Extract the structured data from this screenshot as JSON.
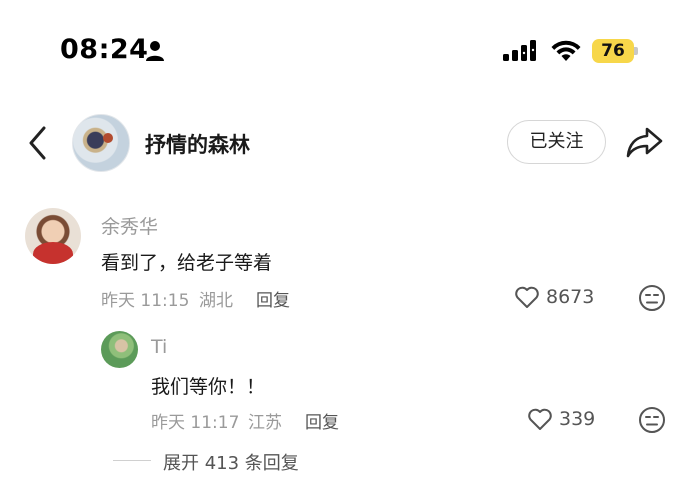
{
  "status_bar": {
    "time": "08:24",
    "battery": "76",
    "icons": [
      "person-icon",
      "signal-icon",
      "wifi-icon",
      "battery-icon"
    ],
    "battery_color": "#f7d74a"
  },
  "header": {
    "title": "抒情的森林",
    "follow_label": "已关注",
    "icons": [
      "back-icon",
      "share-icon"
    ]
  },
  "comment": {
    "username": "余秀华",
    "text": "看到了，给老子等着",
    "time": "昨天 11:15",
    "location": "湖北",
    "reply_label": "回复",
    "likes": "8673"
  },
  "reply": {
    "username": "Ti",
    "text": "我们等你！！",
    "time": "昨天 11:17",
    "location": "江苏",
    "reply_label": "回复",
    "likes": "339"
  },
  "expand_label": "展开 413 条回复"
}
